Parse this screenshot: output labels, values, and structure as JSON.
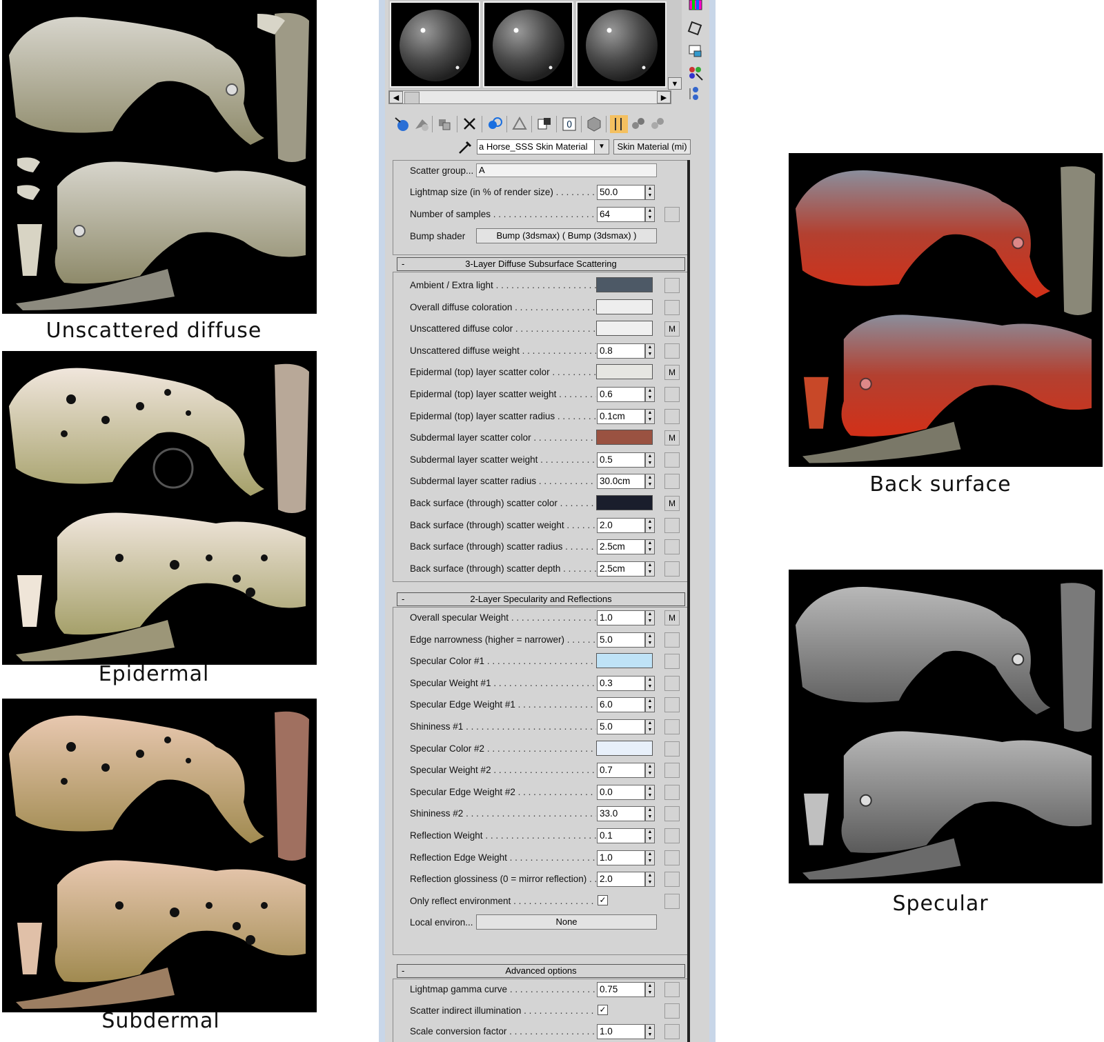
{
  "captions": {
    "unscattered": "Unscattered diffuse",
    "epidermal": "Epidermal",
    "subdermal": "Subdermal",
    "back": "Back surface",
    "specular": "Specular"
  },
  "material": {
    "name": "a Horse_SSS Skin Material",
    "type": "Skin Material (mi)"
  },
  "general": {
    "scatter_group_label": "Scatter group...",
    "scatter_group_value": "A",
    "lightmap_label": "Lightmap size (in % of render size)",
    "lightmap_value": "50.0",
    "samples_label": "Number of samples",
    "samples_value": "64",
    "bump_label": "Bump shader",
    "bump_value": "Bump (3dsmax)  ( Bump (3dsmax) )"
  },
  "sss": {
    "title": "3-Layer Diffuse Subsurface Scattering",
    "rows": [
      {
        "label": "Ambient / Extra light",
        "kind": "color",
        "color": "#4d5966",
        "map": ""
      },
      {
        "label": "Overall diffuse coloration",
        "kind": "color",
        "color": "#eeeeee",
        "map": ""
      },
      {
        "label": "Unscattered diffuse color",
        "kind": "color",
        "color": "#f0f0f0",
        "map": "M"
      },
      {
        "label": "Unscattered diffuse weight",
        "kind": "num",
        "value": "0.8",
        "map": ""
      },
      {
        "label": "Epidermal (top) layer scatter color",
        "kind": "color",
        "color": "#e6e6e2",
        "map": "M"
      },
      {
        "label": "Epidermal (top) layer scatter weight",
        "kind": "num",
        "value": "0.6",
        "map": ""
      },
      {
        "label": "Epidermal (top) layer scatter radius",
        "kind": "num",
        "value": "0.1cm",
        "map": ""
      },
      {
        "label": "Subdermal layer scatter color",
        "kind": "color",
        "color": "#9a5241",
        "map": "M"
      },
      {
        "label": "Subdermal layer scatter weight",
        "kind": "num",
        "value": "0.5",
        "map": ""
      },
      {
        "label": "Subdermal layer scatter radius",
        "kind": "num",
        "value": "30.0cm",
        "map": ""
      },
      {
        "label": "Back surface (through) scatter color",
        "kind": "color",
        "color": "#1a1e2c",
        "map": "M"
      },
      {
        "label": "Back surface (through) scatter weight",
        "kind": "num",
        "value": "2.0",
        "map": ""
      },
      {
        "label": "Back surface (through) scatter radius",
        "kind": "num",
        "value": "2.5cm",
        "map": ""
      },
      {
        "label": "Back surface (through) scatter depth",
        "kind": "num",
        "value": "2.5cm",
        "map": ""
      }
    ]
  },
  "spec": {
    "title": "2-Layer Specularity and Reflections",
    "rows": [
      {
        "label": "Overall specular Weight",
        "kind": "num",
        "value": "1.0",
        "map": "M"
      },
      {
        "label": "Edge narrowness (higher = narrower)",
        "kind": "num",
        "value": "5.0",
        "map": ""
      },
      {
        "label": "Specular Color #1",
        "kind": "color",
        "color": "#bfe3f7",
        "map": ""
      },
      {
        "label": "Specular Weight #1",
        "kind": "num",
        "value": "0.3",
        "map": ""
      },
      {
        "label": "Specular Edge Weight #1",
        "kind": "num",
        "value": "6.0",
        "map": ""
      },
      {
        "label": "Shininess #1",
        "kind": "num",
        "value": "5.0",
        "map": ""
      },
      {
        "label": "Specular Color #2",
        "kind": "color",
        "color": "#e8f0fa",
        "map": ""
      },
      {
        "label": "Specular Weight #2",
        "kind": "num",
        "value": "0.7",
        "map": ""
      },
      {
        "label": "Specular Edge Weight #2",
        "kind": "num",
        "value": "0.0",
        "map": ""
      },
      {
        "label": "Shininess #2",
        "kind": "num",
        "value": "33.0",
        "map": ""
      },
      {
        "label": "Reflection Weight",
        "kind": "num",
        "value": "0.1",
        "map": ""
      },
      {
        "label": "Reflection Edge Weight",
        "kind": "num",
        "value": "1.0",
        "map": ""
      },
      {
        "label": "Reflection glossiness (0 = mirror reflection)",
        "kind": "num",
        "value": "2.0",
        "map": ""
      },
      {
        "label": "Only reflect environment",
        "kind": "check",
        "value": "✓",
        "map": ""
      }
    ],
    "local_env_label": "Local environ...",
    "local_env_value": "None"
  },
  "advanced": {
    "title": "Advanced options",
    "rows": [
      {
        "label": "Lightmap gamma curve",
        "kind": "num",
        "value": "0.75",
        "map": ""
      },
      {
        "label": "Scatter indirect illumination",
        "kind": "check",
        "value": "✓",
        "map": ""
      },
      {
        "label": "Scale conversion factor",
        "kind": "num",
        "value": "1.0",
        "map": ""
      }
    ]
  },
  "icons": [
    "get-material-icon",
    "put-to-scene-icon",
    "assign-to-selection-icon",
    "delete-icon",
    "make-unique-icon",
    "put-to-library-icon",
    "material-id-icon",
    "show-map-icon",
    "show-end-result-icon",
    "go-to-parent-icon",
    "go-sibling-icon",
    "eyedropper-icon"
  ]
}
